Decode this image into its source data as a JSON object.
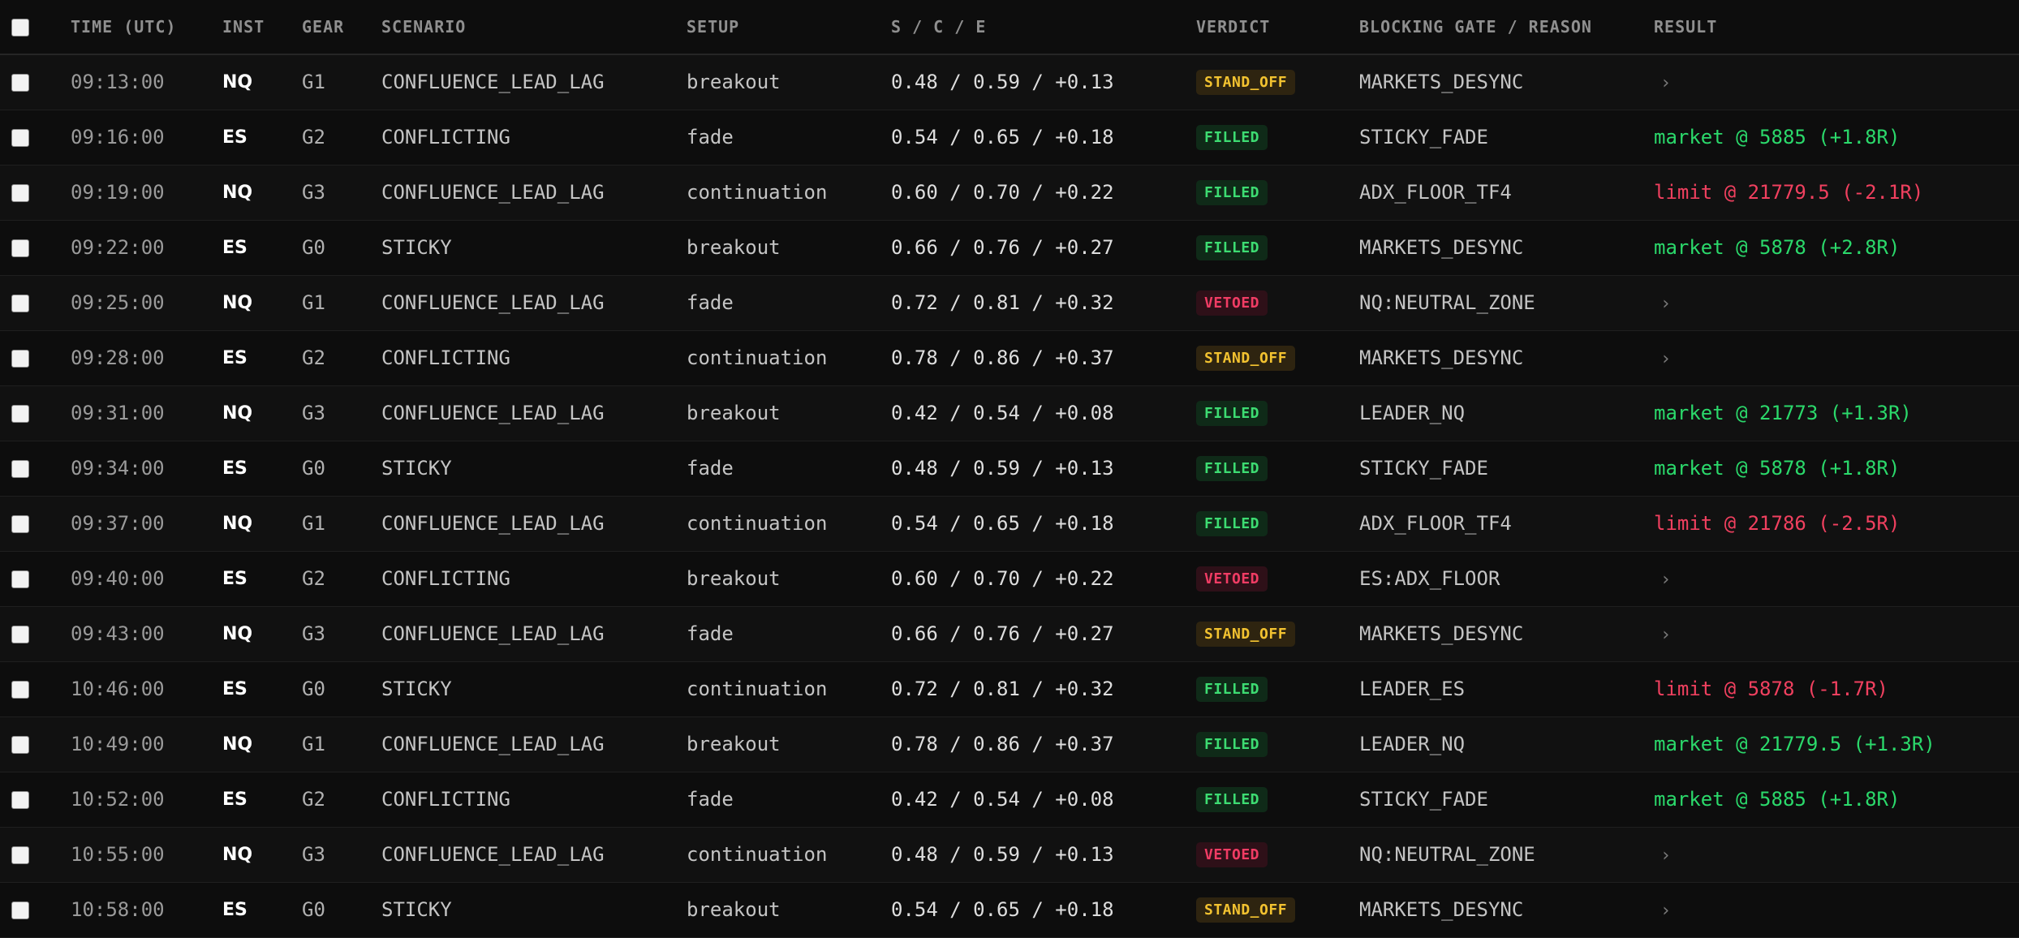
{
  "columns": {
    "time": "TIME (UTC)",
    "inst": "INST",
    "gear": "GEAR",
    "scenario": "SCENARIO",
    "setup": "SETUP",
    "sce": "S / C / E",
    "verdict": "VERDICT",
    "reason": "BLOCKING GATE / REASON",
    "result": "RESULT"
  },
  "colors": {
    "background": "#0d0d0d",
    "filled": "#3ddc72",
    "stand_off": "#f2c230",
    "vetoed": "#f03c64",
    "result_positive": "#2bd96b",
    "result_negative": "#f0405f"
  },
  "rows": [
    {
      "time": "09:13:00",
      "inst": "NQ",
      "gear": "G1",
      "scenario": "CONFLUENCE_LEAD_LAG",
      "setup": "breakout",
      "sce": "0.48 / 0.59 / +0.13",
      "verdict": "STAND_OFF",
      "reason": "MARKETS_DESYNC",
      "result": "›",
      "result_kind": "none"
    },
    {
      "time": "09:16:00",
      "inst": "ES",
      "gear": "G2",
      "scenario": "CONFLICTING",
      "setup": "fade",
      "sce": "0.54 / 0.65 / +0.18",
      "verdict": "FILLED",
      "reason": "STICKY_FADE",
      "result": "market @ 5885 (+1.8R)",
      "result_kind": "pos"
    },
    {
      "time": "09:19:00",
      "inst": "NQ",
      "gear": "G3",
      "scenario": "CONFLUENCE_LEAD_LAG",
      "setup": "continuation",
      "sce": "0.60 / 0.70 / +0.22",
      "verdict": "FILLED",
      "reason": "ADX_FLOOR_TF4",
      "result": "limit @ 21779.5 (-2.1R)",
      "result_kind": "neg"
    },
    {
      "time": "09:22:00",
      "inst": "ES",
      "gear": "G0",
      "scenario": "STICKY",
      "setup": "breakout",
      "sce": "0.66 / 0.76 / +0.27",
      "verdict": "FILLED",
      "reason": "MARKETS_DESYNC",
      "result": "market @ 5878 (+2.8R)",
      "result_kind": "pos"
    },
    {
      "time": "09:25:00",
      "inst": "NQ",
      "gear": "G1",
      "scenario": "CONFLUENCE_LEAD_LAG",
      "setup": "fade",
      "sce": "0.72 / 0.81 / +0.32",
      "verdict": "VETOED",
      "reason": "NQ:NEUTRAL_ZONE",
      "result": "›",
      "result_kind": "none"
    },
    {
      "time": "09:28:00",
      "inst": "ES",
      "gear": "G2",
      "scenario": "CONFLICTING",
      "setup": "continuation",
      "sce": "0.78 / 0.86 / +0.37",
      "verdict": "STAND_OFF",
      "reason": "MARKETS_DESYNC",
      "result": "›",
      "result_kind": "none"
    },
    {
      "time": "09:31:00",
      "inst": "NQ",
      "gear": "G3",
      "scenario": "CONFLUENCE_LEAD_LAG",
      "setup": "breakout",
      "sce": "0.42 / 0.54 / +0.08",
      "verdict": "FILLED",
      "reason": "LEADER_NQ",
      "result": "market @ 21773 (+1.3R)",
      "result_kind": "pos"
    },
    {
      "time": "09:34:00",
      "inst": "ES",
      "gear": "G0",
      "scenario": "STICKY",
      "setup": "fade",
      "sce": "0.48 / 0.59 / +0.13",
      "verdict": "FILLED",
      "reason": "STICKY_FADE",
      "result": "market @ 5878 (+1.8R)",
      "result_kind": "pos"
    },
    {
      "time": "09:37:00",
      "inst": "NQ",
      "gear": "G1",
      "scenario": "CONFLUENCE_LEAD_LAG",
      "setup": "continuation",
      "sce": "0.54 / 0.65 / +0.18",
      "verdict": "FILLED",
      "reason": "ADX_FLOOR_TF4",
      "result": "limit @ 21786 (-2.5R)",
      "result_kind": "neg"
    },
    {
      "time": "09:40:00",
      "inst": "ES",
      "gear": "G2",
      "scenario": "CONFLICTING",
      "setup": "breakout",
      "sce": "0.60 / 0.70 / +0.22",
      "verdict": "VETOED",
      "reason": "ES:ADX_FLOOR",
      "result": "›",
      "result_kind": "none"
    },
    {
      "time": "09:43:00",
      "inst": "NQ",
      "gear": "G3",
      "scenario": "CONFLUENCE_LEAD_LAG",
      "setup": "fade",
      "sce": "0.66 / 0.76 / +0.27",
      "verdict": "STAND_OFF",
      "reason": "MARKETS_DESYNC",
      "result": "›",
      "result_kind": "none"
    },
    {
      "time": "10:46:00",
      "inst": "ES",
      "gear": "G0",
      "scenario": "STICKY",
      "setup": "continuation",
      "sce": "0.72 / 0.81 / +0.32",
      "verdict": "FILLED",
      "reason": "LEADER_ES",
      "result": "limit @ 5878 (-1.7R)",
      "result_kind": "neg"
    },
    {
      "time": "10:49:00",
      "inst": "NQ",
      "gear": "G1",
      "scenario": "CONFLUENCE_LEAD_LAG",
      "setup": "breakout",
      "sce": "0.78 / 0.86 / +0.37",
      "verdict": "FILLED",
      "reason": "LEADER_NQ",
      "result": "market @ 21779.5 (+1.3R)",
      "result_kind": "pos"
    },
    {
      "time": "10:52:00",
      "inst": "ES",
      "gear": "G2",
      "scenario": "CONFLICTING",
      "setup": "fade",
      "sce": "0.42 / 0.54 / +0.08",
      "verdict": "FILLED",
      "reason": "STICKY_FADE",
      "result": "market @ 5885 (+1.8R)",
      "result_kind": "pos"
    },
    {
      "time": "10:55:00",
      "inst": "NQ",
      "gear": "G3",
      "scenario": "CONFLUENCE_LEAD_LAG",
      "setup": "continuation",
      "sce": "0.48 / 0.59 / +0.13",
      "verdict": "VETOED",
      "reason": "NQ:NEUTRAL_ZONE",
      "result": "›",
      "result_kind": "none"
    },
    {
      "time": "10:58:00",
      "inst": "ES",
      "gear": "G0",
      "scenario": "STICKY",
      "setup": "breakout",
      "sce": "0.54 / 0.65 / +0.18",
      "verdict": "STAND_OFF",
      "reason": "MARKETS_DESYNC",
      "result": "›",
      "result_kind": "none"
    }
  ]
}
